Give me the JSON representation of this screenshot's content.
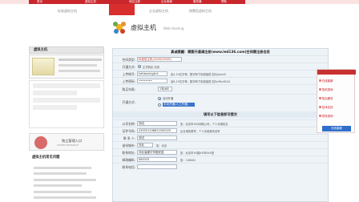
{
  "nav": {
    "tabs": [
      "首页",
      "虚拟主机",
      "域名注册",
      "企业邮局",
      "服务器",
      "帮助"
    ],
    "sub_items": [
      "标准虚拟主机",
      "企业虚拟主机",
      "按需型虚拟主机"
    ]
  },
  "header": {
    "title": "虚拟主机",
    "subtitle": "Web Hosting"
  },
  "left": {
    "panel_title": "虚拟主机",
    "hosting_label": "虚拟主机 Days • virtual host",
    "admin_title": "独立管理入口",
    "admin_sub": "ADMIN ENTRANCE",
    "faq_title": "虚拟主机常见问题"
  },
  "form": {
    "notice": "真诚提醒：需要开通请注册(www.led136.com)空间需注册会员",
    "rows": [
      {
        "label": "空间类型:",
        "value": "标准型主机(200M/200M)",
        "hint": ""
      },
      {
        "label": "开通方式:",
        "value": "",
        "hint": "正式购买   试用"
      },
      {
        "label": "上传帐号:",
        "value": "hetianxingjin1",
        "hint": "由4-10位字母、数字和下划线组成 如为jiaxin5"
      },
      {
        "label": "上传密码:",
        "value": "••••••••",
        "hint": "由6-15位字母、数字和下划线组成 如为cRkc8244"
      },
      {
        "label": "购买年限:",
        "value": "1年(68元)",
        "hint": ""
      },
      {
        "label": "开通方式:",
        "value": "",
        "hint": ""
      }
    ],
    "open_option_1": "自动开通",
    "open_option_2": "手动开通(人工开通)",
    "section2_title": "填写以下信息即可提交",
    "rows2": [
      {
        "label": "公司名称:",
        "value": "测试",
        "hint": "如：北京市XXX网络公司，个人请填姓名"
      },
      {
        "label": "证件号码:",
        "value": "430321198812302525",
        "hint": "企业填执照号，个人请填身份证号"
      },
      {
        "label": "联 系 人:",
        "value": "测试",
        "hint": ""
      },
      {
        "label": "省份城市:",
        "value": "河北",
        "hint": "如：北京"
      },
      {
        "label": "联系地址:",
        "value": "河北省廊坊市固安县",
        "hint": "如：北京市XX路XX号XXX室"
      },
      {
        "label": "邮政编码:",
        "value": "065333",
        "hint": "如：100002"
      },
      {
        "label": "联系电话:",
        "value": "",
        "hint": ""
      }
    ]
  },
  "sidebar": {
    "items": [
      "在线客服",
      "售前咨询",
      "售后服务",
      "技术支持",
      "财务咨询"
    ],
    "button": "在线客服"
  },
  "colors": {
    "brand_red": "#c9272c",
    "form_bg": "#eef3f7",
    "select_blue": "#3b73c8"
  }
}
